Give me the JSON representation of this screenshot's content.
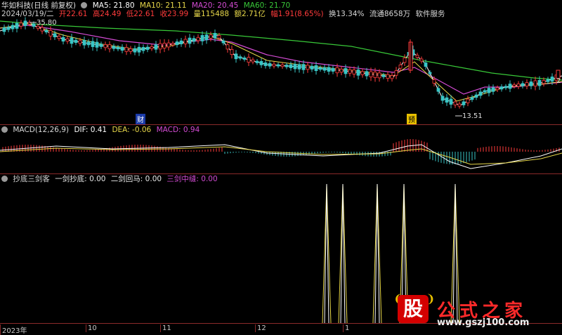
{
  "main_panel": {
    "title": "华如科技(日线 前复权)",
    "ma": [
      {
        "label": "MA5: 21.80",
        "color": "#ffffff"
      },
      {
        "label": "MA10: 21.11",
        "color": "#e8d84a"
      },
      {
        "label": "MA20: 20.45",
        "color": "#d34bd3"
      },
      {
        "label": "MA60: 21.70",
        "color": "#38c838"
      }
    ],
    "quote": {
      "date": "2024/03/19/二",
      "open": "开22.61",
      "high": "高24.49",
      "low": "低22.61",
      "close": "收23.99",
      "volume": "量115488",
      "amount": "额2.71亿",
      "amplitude": "幅1.91(8.65%)",
      "turnover": "换13.34%",
      "float": "流通8658万",
      "sector": "软件服务"
    },
    "price_high_label": "35.80",
    "price_low_label": "13.51",
    "price_right_label": "2",
    "marker_cai": "财",
    "marker_yu": "预"
  },
  "macd_panel": {
    "title": "MACD(12,26,9)",
    "dif": "DIF: 0.41",
    "dea": "DEA: -0.06",
    "macd": "MACD: 0.94"
  },
  "indicator_panel": {
    "title": "抄底三剑客",
    "items": [
      {
        "label": "一剑抄底: 0.00",
        "color": "#e8e8e8"
      },
      {
        "label": "二剑回马: 0.00",
        "color": "#e8e8e8"
      },
      {
        "label": "三剑中缝: 0.00",
        "color": "#d34bd3"
      }
    ],
    "spike_x": [
      465,
      488,
      537,
      575,
      648
    ]
  },
  "x_axis": {
    "labels": [
      "2023年",
      "10",
      "11",
      "12",
      "1"
    ]
  },
  "watermark": {
    "logo_char": "股",
    "name": "公式之家",
    "url": "www.gszj100.com"
  },
  "colors": {
    "up": "#ff3b3b",
    "down": "#39c5c5",
    "grid": "#8a2a2a",
    "ma5": "#ffffff",
    "ma10": "#e8d84a",
    "ma20": "#d34bd3",
    "ma60": "#38c838"
  }
}
